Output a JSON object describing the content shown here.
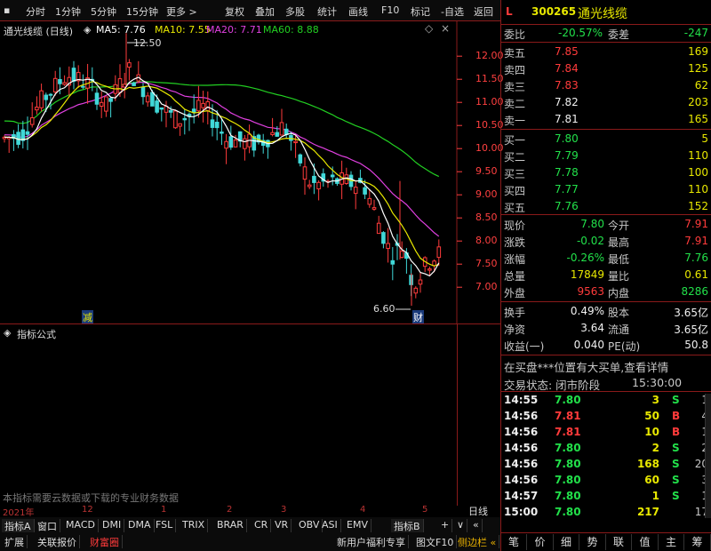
{
  "toolbar": {
    "items": [
      "分时",
      "1分钟",
      "5分钟",
      "15分钟",
      "更多 >",
      "复权",
      "叠加",
      "多股",
      "统计",
      "画线",
      "F10",
      "标记",
      "-自选",
      "返回"
    ]
  },
  "chart_title": "通光线缆 (日线)",
  "ma": {
    "ma5": "MA5: 7.76",
    "ma10": "MA10: 7.55",
    "ma20": "MA20: 7.71",
    "ma60": "MA60: 8.88"
  },
  "colors": {
    "ma5": "#ffffff",
    "ma10": "#e8e800",
    "ma20": "#e040e0",
    "ma60": "#22d022",
    "up": "#ff3b3b",
    "down": "#40d8d8"
  },
  "chart_data": {
    "type": "candlestick",
    "y_ticks": [
      "12.00",
      "11.50",
      "11.00",
      "10.50",
      "10.00",
      "9.50",
      "9.00",
      "8.50",
      "8.00",
      "7.50",
      "7.00"
    ],
    "ylim": [
      6.6,
      12.6
    ],
    "high_label": "12.50",
    "low_label": "6.60",
    "x_labels": [
      "2021年",
      "12",
      "1",
      "2",
      "3",
      "4",
      "5"
    ],
    "markers": [
      "减",
      "财"
    ]
  },
  "indicator": {
    "title": "指标公式",
    "note": "本指标需要云数据或下载的专业财务数据"
  },
  "axis_label": "日线",
  "indicator_tabs": [
    "指标A",
    "窗口",
    "MACD",
    "DMI",
    "DMA",
    "FSL",
    "TRIX",
    "BRAR",
    "CR",
    "VR",
    "OBV",
    "ASI",
    "EMV",
    "指标B",
    "+",
    "∨",
    "«"
  ],
  "bottom_tabs": [
    "扩展",
    "关联报价",
    "财富圈"
  ],
  "promo": [
    "新用户福利专享",
    "图文F10",
    "侧边栏 «"
  ],
  "stock": {
    "flag": "L",
    "code": "300265",
    "name": "通光线缆"
  },
  "weibi": {
    "label1": "委比",
    "value1": "-20.57%",
    "label2": "委差",
    "value2": "-247"
  },
  "sell": [
    {
      "label": "卖五",
      "price": "7.85",
      "vol": "169"
    },
    {
      "label": "卖四",
      "price": "7.84",
      "vol": "125"
    },
    {
      "label": "卖三",
      "price": "7.83",
      "vol": "62"
    },
    {
      "label": "卖二",
      "price": "7.82",
      "vol": "203"
    },
    {
      "label": "卖一",
      "price": "7.81",
      "vol": "165"
    }
  ],
  "buy": [
    {
      "label": "买一",
      "price": "7.80",
      "vol": "5"
    },
    {
      "label": "买二",
      "price": "7.79",
      "vol": "110"
    },
    {
      "label": "买三",
      "price": "7.78",
      "vol": "100"
    },
    {
      "label": "买四",
      "price": "7.77",
      "vol": "110"
    },
    {
      "label": "买五",
      "price": "7.76",
      "vol": "152"
    }
  ],
  "quote": [
    {
      "l1": "现价",
      "v1": "7.80",
      "l2": "今开",
      "v2": "7.91"
    },
    {
      "l1": "涨跌",
      "v1": "-0.02",
      "l2": "最高",
      "v2": "7.91"
    },
    {
      "l1": "涨幅",
      "v1": "-0.26%",
      "l2": "最低",
      "v2": "7.76"
    },
    {
      "l1": "总量",
      "v1": "17849",
      "l2": "量比",
      "v2": "0.61"
    },
    {
      "l1": "外盘",
      "v1": "9563",
      "l2": "内盘",
      "v2": "8286"
    }
  ],
  "fund": [
    {
      "l1": "换手",
      "v1": "0.49%",
      "l2": "股本",
      "v2": "3.65亿"
    },
    {
      "l1": "净资",
      "v1": "3.64",
      "l2": "流通",
      "v2": "3.65亿"
    },
    {
      "l1": "收益(一)",
      "v1": "0.040",
      "l2": "PE(动)",
      "v2": "50.8"
    }
  ],
  "notice": "在买盘***位置有大买单,查看详情",
  "trade_status": {
    "label": "交易状态: 闭市阶段",
    "time": "15:30:00"
  },
  "ticks": [
    {
      "t": "14:55",
      "p": "7.80",
      "v": "3",
      "d": "S",
      "n": "1"
    },
    {
      "t": "14:56",
      "p": "7.81",
      "v": "50",
      "d": "B",
      "n": "4"
    },
    {
      "t": "14:56",
      "p": "7.81",
      "v": "10",
      "d": "B",
      "n": "1"
    },
    {
      "t": "14:56",
      "p": "7.80",
      "v": "2",
      "d": "S",
      "n": "2"
    },
    {
      "t": "14:56",
      "p": "7.80",
      "v": "168",
      "d": "S",
      "n": "20"
    },
    {
      "t": "14:56",
      "p": "7.80",
      "v": "60",
      "d": "S",
      "n": "3"
    },
    {
      "t": "14:57",
      "p": "7.80",
      "v": "1",
      "d": "S",
      "n": "1"
    },
    {
      "t": "15:00",
      "p": "7.80",
      "v": "217",
      "d": "",
      "n": "17"
    }
  ],
  "nav_tabs": [
    "笔",
    "价",
    "细",
    "势",
    "联",
    "值",
    "主",
    "筹"
  ]
}
